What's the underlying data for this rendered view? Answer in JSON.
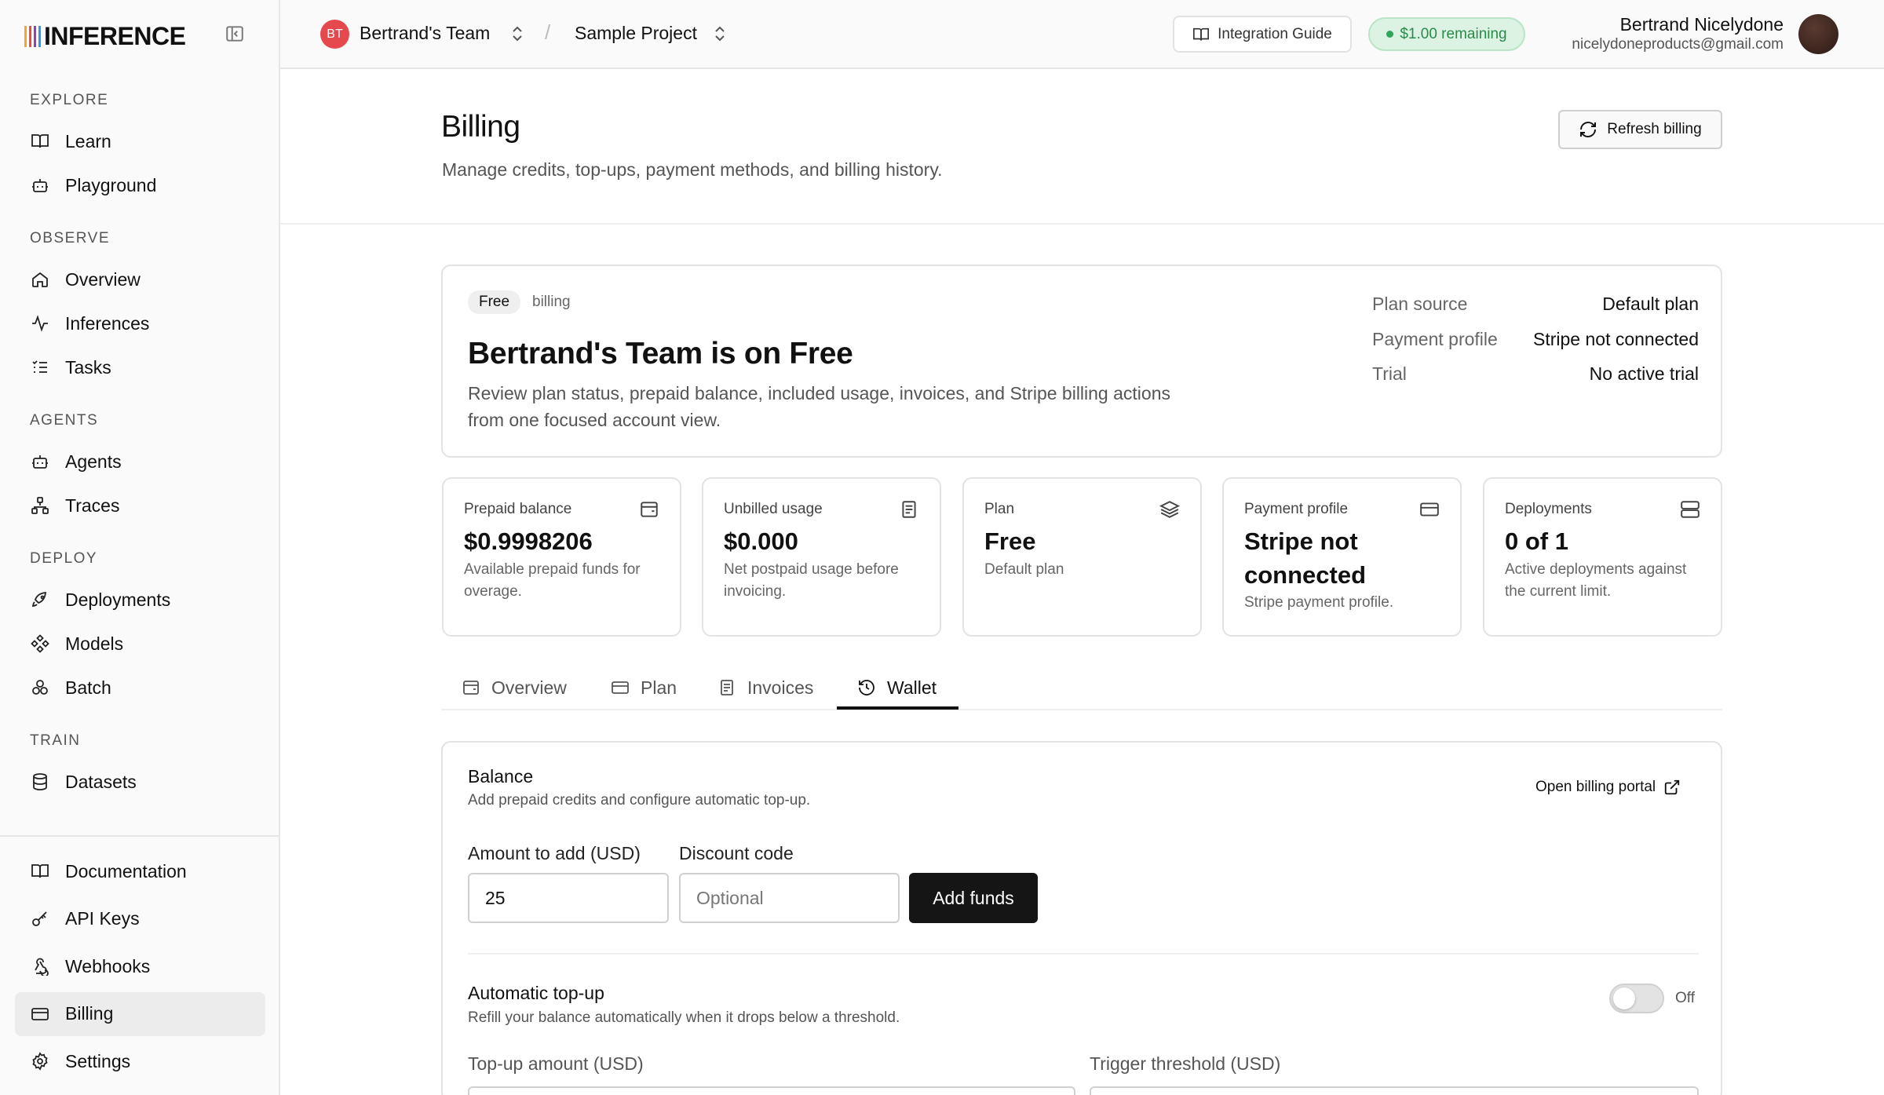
{
  "brand": {
    "logo_text": "INFERENCE",
    "bar_colors": [
      "#f5a623",
      "#e94e3c",
      "#8e44ad",
      "#3498db"
    ]
  },
  "sidebar": {
    "sections": [
      {
        "label": "EXPLORE",
        "items": [
          {
            "label": "Learn",
            "icon": "book-icon"
          },
          {
            "label": "Playground",
            "icon": "bot-icon"
          }
        ]
      },
      {
        "label": "OBSERVE",
        "items": [
          {
            "label": "Overview",
            "icon": "home-icon"
          },
          {
            "label": "Inferences",
            "icon": "activity-icon"
          },
          {
            "label": "Tasks",
            "icon": "list-check-icon"
          }
        ]
      },
      {
        "label": "AGENTS",
        "items": [
          {
            "label": "Agents",
            "icon": "bot-icon"
          },
          {
            "label": "Traces",
            "icon": "workflow-icon"
          }
        ]
      },
      {
        "label": "DEPLOY",
        "items": [
          {
            "label": "Deployments",
            "icon": "rocket-icon"
          },
          {
            "label": "Models",
            "icon": "nodes-icon"
          },
          {
            "label": "Batch",
            "icon": "cluster-icon"
          }
        ]
      },
      {
        "label": "TRAIN",
        "items": [
          {
            "label": "Datasets",
            "icon": "database-icon"
          }
        ]
      }
    ],
    "bottom_items": [
      {
        "label": "Documentation",
        "icon": "book-icon"
      },
      {
        "label": "API Keys",
        "icon": "key-icon"
      },
      {
        "label": "Webhooks",
        "icon": "webhook-icon"
      },
      {
        "label": "Billing",
        "icon": "credit-card-icon",
        "active": true
      },
      {
        "label": "Settings",
        "icon": "gear-icon"
      }
    ]
  },
  "header": {
    "team_initials": "BT",
    "team_name": "Bertrand's Team",
    "separator": "/",
    "project_name": "Sample Project",
    "guide_label": "Integration Guide",
    "credits_label": "$1.00 remaining",
    "user_name": "Bertrand Nicelydone",
    "user_email": "nicelydoneproducts@gmail.com"
  },
  "page": {
    "title": "Billing",
    "subtitle": "Manage credits, top-ups, payment methods, and billing history.",
    "refresh_label": "Refresh billing"
  },
  "plan_card": {
    "badge": "Free",
    "badge_suffix": "billing",
    "title": "Bertrand's Team is on Free",
    "description": "Review plan status, prepaid balance, included usage, invoices, and Stripe billing actions from one focused account view.",
    "details": [
      {
        "key": "Plan source",
        "value": "Default plan"
      },
      {
        "key": "Payment profile",
        "value": "Stripe not connected"
      },
      {
        "key": "Trial",
        "value": "No active trial"
      }
    ]
  },
  "stats": [
    {
      "label": "Prepaid balance",
      "value": "$0.9998206",
      "desc": "Available prepaid funds for overage.",
      "icon": "wallet-icon"
    },
    {
      "label": "Unbilled usage",
      "value": "$0.000",
      "desc": "Net postpaid usage before invoicing.",
      "icon": "receipt-icon"
    },
    {
      "label": "Plan",
      "value": "Free",
      "desc": "Default plan",
      "icon": "layers-icon"
    },
    {
      "label": "Payment profile",
      "value": "Stripe not connected",
      "desc": "Stripe payment profile.",
      "icon": "credit-card-icon"
    },
    {
      "label": "Deployments",
      "value": "0 of 1",
      "desc": "Active deployments against the current limit.",
      "icon": "server-icon"
    }
  ],
  "tabs": [
    {
      "label": "Overview",
      "icon": "wallet-icon"
    },
    {
      "label": "Plan",
      "icon": "credit-card-icon"
    },
    {
      "label": "Invoices",
      "icon": "receipt-icon"
    },
    {
      "label": "Wallet",
      "icon": "history-icon",
      "active": true
    }
  ],
  "wallet": {
    "title": "Balance",
    "subtitle": "Add prepaid credits and configure automatic top-up.",
    "portal_label": "Open billing portal",
    "amount_label": "Amount to add (USD)",
    "amount_value": "25",
    "discount_label": "Discount code",
    "discount_placeholder": "Optional",
    "add_label": "Add funds",
    "auto_title": "Automatic top-up",
    "auto_subtitle": "Refill your balance automatically when it drops below a threshold.",
    "auto_state": "Off",
    "topup_label": "Top-up amount (USD)",
    "threshold_label": "Trigger threshold (USD)"
  }
}
